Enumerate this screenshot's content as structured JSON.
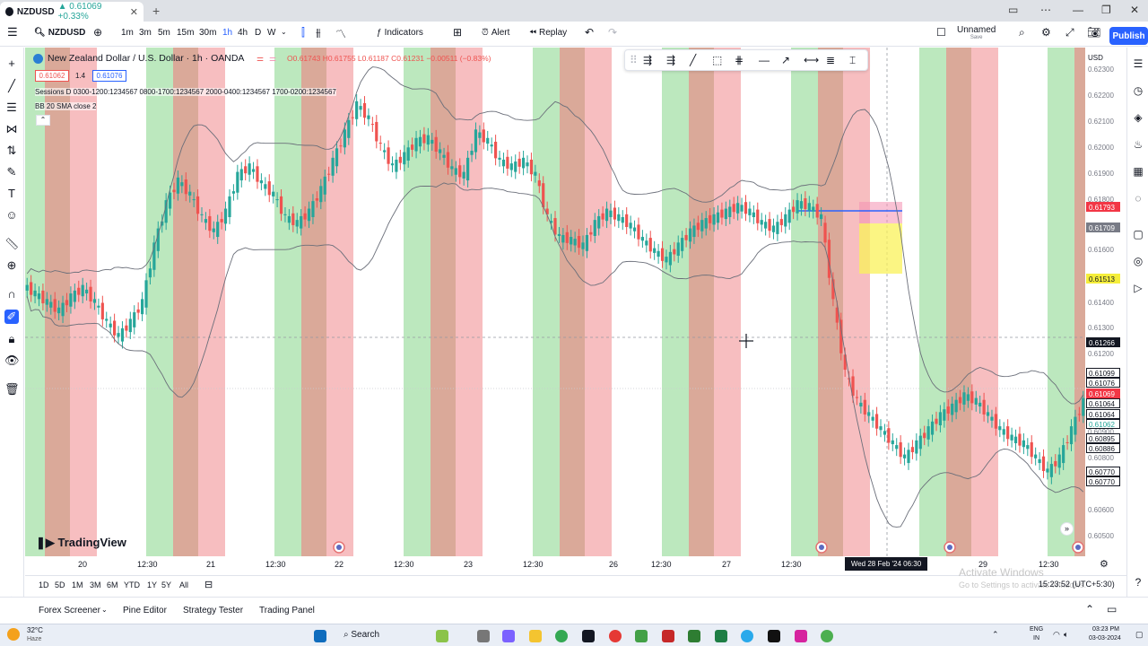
{
  "browser": {
    "tab_symbol": "NZDUSD",
    "tab_change": "▲ 0.61069 +0.33%"
  },
  "toolbar": {
    "symbol": "NZDUSD",
    "intervals": [
      "1m",
      "3m",
      "5m",
      "15m",
      "30m",
      "1h",
      "4h",
      "D",
      "W"
    ],
    "indicators_label": "Indicators",
    "alert_label": "Alert",
    "replay_label": "Replay",
    "layout_name": "Unnamed",
    "layout_sub": "Save",
    "publish_label": "Publish"
  },
  "legend": {
    "title": "New Zealand Dollar / U.S. Dollar · 1h · OANDA",
    "ohlc": "O0.61743 H0.61755 L0.61187 C0.61231 −0.00511 (−0.83%)",
    "bid": "0.61062",
    "spread": "1.4",
    "ask": "0.61076",
    "sessions": "Sessions D 0300-1200:1234567 0800-1700:1234567 2000-0400:1234567 1700-0200:1234567",
    "bb": "BB 20 SMA close 2"
  },
  "price_axis": {
    "currency": "USD",
    "labels": [
      "0.62300",
      "0.62200",
      "0.62100",
      "0.62000",
      "0.61900",
      "0.61800",
      "0.61600",
      "0.61400",
      "0.61300",
      "0.61200",
      "0.61100",
      "0.61000",
      "0.60900",
      "0.60800",
      "0.60700",
      "0.60600",
      "0.60500"
    ],
    "tags": [
      {
        "text": "0.61793",
        "kind": "red"
      },
      {
        "text": "0.61709",
        "kind": "grey"
      },
      {
        "text": "0.61513",
        "kind": "yellow"
      },
      {
        "text": "0.61266",
        "kind": "dark"
      },
      {
        "text": "0.61099",
        "kind": "plain"
      },
      {
        "text": "0.61076",
        "kind": "plain"
      },
      {
        "text": "0.61069",
        "kind": "red"
      },
      {
        "text": "0.61064",
        "kind": "plain"
      },
      {
        "text": "0.61064",
        "kind": "plain"
      },
      {
        "text": "0.61062",
        "kind": "green"
      },
      {
        "text": "0.60895",
        "kind": "plain"
      },
      {
        "text": "0.60886",
        "kind": "plain"
      },
      {
        "text": "0.60770",
        "kind": "plain"
      },
      {
        "text": "0.60770",
        "kind": "plain"
      }
    ]
  },
  "time_axis": {
    "labels": [
      "20",
      "12:30",
      "21",
      "12:30",
      "22",
      "12:30",
      "23",
      "12:30",
      "26",
      "12:30",
      "27",
      "12:30",
      "29",
      "12:30"
    ],
    "crosshair_time": "Wed 28 Feb '24   06:30"
  },
  "range_bar": {
    "ranges": [
      "1D",
      "5D",
      "1M",
      "3M",
      "6M",
      "YTD",
      "1Y",
      "5Y",
      "All"
    ],
    "clock": "15:23:52 (UTC+5:30)"
  },
  "bottom_panel": {
    "tabs": [
      "Forex Screener",
      "Pine Editor",
      "Strategy Tester",
      "Trading Panel"
    ]
  },
  "watermark": {
    "logo": "TradingView",
    "activate_title": "Activate Windows",
    "activate_sub": "Go to Settings to activate Windows."
  },
  "taskbar": {
    "weather_temp": "32°C",
    "weather_desc": "Haze",
    "search_label": "Search",
    "lang": "ENG",
    "region": "IN",
    "time": "03:23 PM",
    "date": "03-03-2024"
  },
  "colors": {
    "bull": "#26a69a",
    "bear": "#ef5350",
    "session_green": "#b5e5b7",
    "session_red": "#f6b3b5",
    "session_brown": "#d6a08e",
    "accent": "#2962ff"
  },
  "chart_data": {
    "type": "candlestick",
    "title": "New Zealand Dollar / U.S. Dollar · 1h · OANDA",
    "ylim": [
      0.605,
      0.623
    ],
    "close_path": [
      0.6143,
      0.614,
      0.6137,
      0.6142,
      0.6145,
      0.614,
      0.6133,
      0.6128,
      0.6133,
      0.614,
      0.616,
      0.6175,
      0.6183,
      0.6178,
      0.617,
      0.6165,
      0.6172,
      0.6185,
      0.6188,
      0.6182,
      0.6178,
      0.617,
      0.6168,
      0.6172,
      0.618,
      0.619,
      0.62,
      0.621,
      0.6205,
      0.6195,
      0.6188,
      0.6192,
      0.6197,
      0.6198,
      0.6193,
      0.6187,
      0.6185,
      0.62,
      0.6197,
      0.619,
      0.6188,
      0.619,
      0.6185,
      0.617,
      0.6163,
      0.6162,
      0.616,
      0.6168,
      0.6172,
      0.617,
      0.6167,
      0.6162,
      0.6158,
      0.6155,
      0.616,
      0.6165,
      0.6168,
      0.617,
      0.6172,
      0.6174,
      0.6172,
      0.6168,
      0.6166,
      0.617,
      0.6175,
      0.6174,
      0.617,
      0.614,
      0.6115,
      0.6105,
      0.61,
      0.6095,
      0.609,
      0.6085,
      0.609,
      0.6095,
      0.61,
      0.6103,
      0.6107,
      0.6105,
      0.61,
      0.6095,
      0.6092,
      0.609,
      0.6085,
      0.608,
      0.6085,
      0.6095,
      0.6105
    ]
  }
}
